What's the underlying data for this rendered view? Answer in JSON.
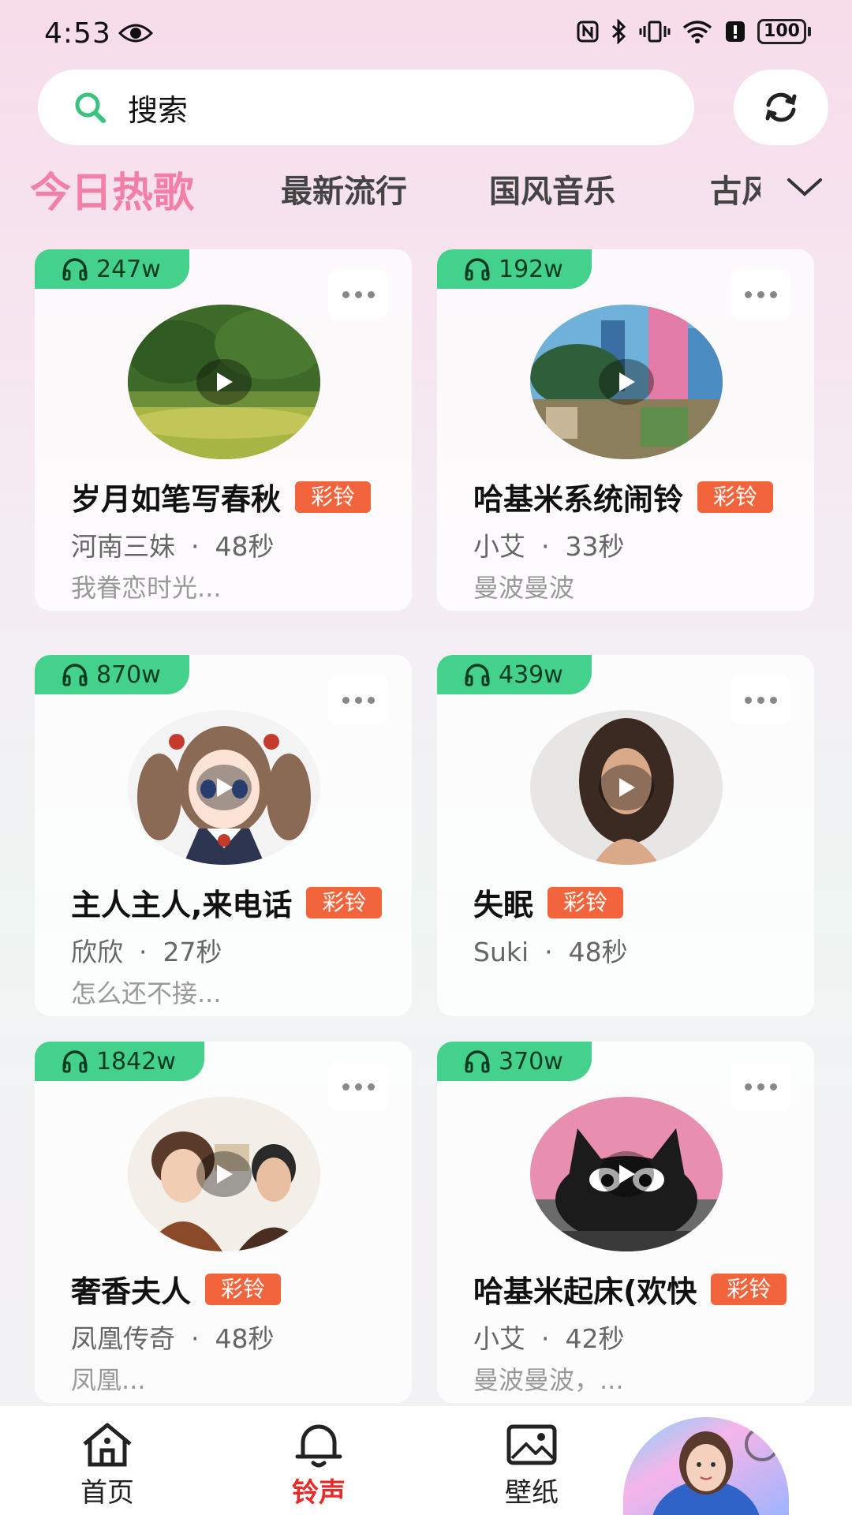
{
  "status_bar": {
    "time": "4:53",
    "battery": "100"
  },
  "search": {
    "placeholder": "搜索"
  },
  "tabs": [
    {
      "label": "今日热歌",
      "active": true
    },
    {
      "label": "最新流行",
      "active": false
    },
    {
      "label": "国风音乐",
      "active": false
    },
    {
      "label": "古风",
      "active": false
    }
  ],
  "cards": [
    {
      "plays": "247w",
      "title": "岁月如笔写春秋",
      "tag": "彩铃",
      "artist": "河南三妹",
      "duration": "48秒",
      "desc": "我眷恋时光...",
      "cover": "forest"
    },
    {
      "plays": "192w",
      "title": "哈基米系统闹铃",
      "tag": "彩铃",
      "artist": "小艾",
      "duration": "33秒",
      "desc": "曼波曼波",
      "cover": "city"
    },
    {
      "plays": "870w",
      "title": "主人主人,来电话",
      "tag": "彩铃",
      "artist": "欣欣",
      "duration": "27秒",
      "desc": "怎么还不接...",
      "cover": "anime"
    },
    {
      "plays": "439w",
      "title": "失眠",
      "tag": "彩铃",
      "artist": "Suki",
      "duration": "48秒",
      "desc": "",
      "cover": "portrait"
    },
    {
      "plays": "1842w",
      "title": "奢香夫人",
      "tag": "彩铃",
      "artist": "凤凰传奇",
      "duration": "48秒",
      "desc": "凤凰...",
      "cover": "duo"
    },
    {
      "plays": "370w",
      "title": "哈基米起床(欢快",
      "tag": "彩铃",
      "artist": "小艾",
      "duration": "42秒",
      "desc": "曼波曼波，...",
      "cover": "cat"
    }
  ],
  "meta_separator": "·",
  "bottom_nav": [
    {
      "label": "首页",
      "icon": "home-icon",
      "active": false
    },
    {
      "label": "铃声",
      "icon": "bell-icon",
      "active": true
    },
    {
      "label": "壁纸",
      "icon": "image-icon",
      "active": false
    }
  ],
  "colors": {
    "accent_tab": "#f27fa6",
    "badge": "#43d18b",
    "tag": "#f2643c",
    "nav_active": "#e62b2b"
  }
}
